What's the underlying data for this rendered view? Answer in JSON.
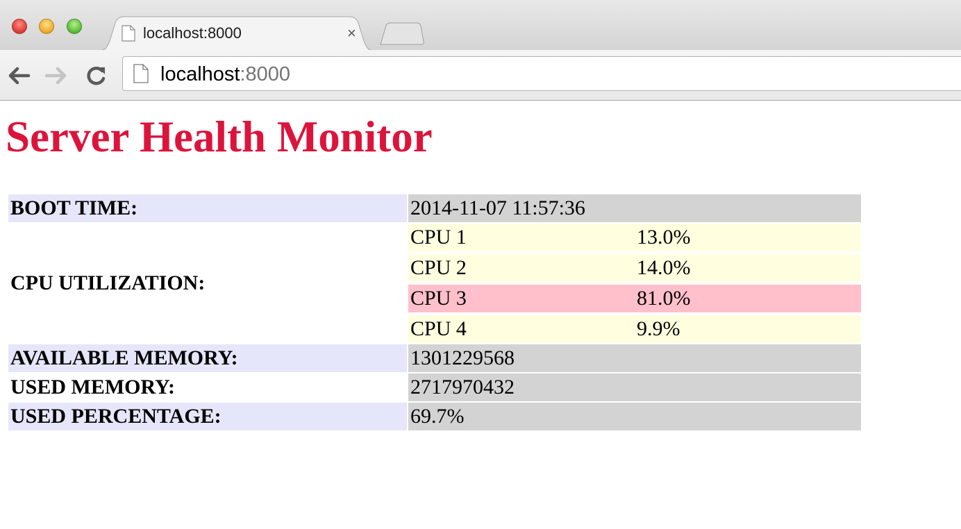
{
  "browser": {
    "tab_title": "localhost:8000",
    "tab_close": "×",
    "address_host": "localhost",
    "address_port": ":8000",
    "icons": [
      "page-icon",
      "back-arrow-icon",
      "forward-arrow-icon",
      "reload-icon",
      "close-icon"
    ]
  },
  "page": {
    "title": "Server Health Monitor",
    "title_color": "#dc143c"
  },
  "stats": {
    "boot_time": {
      "label": "BOOT TIME:",
      "value": "2014-11-07 11:57:36"
    },
    "cpu": {
      "label": "CPU UTILIZATION:",
      "cores": [
        {
          "name": "CPU 1",
          "value": "13.0%"
        },
        {
          "name": "CPU 2",
          "value": "14.0%"
        },
        {
          "name": "CPU 3",
          "value": "81.0%",
          "status": "high"
        },
        {
          "name": "CPU 4",
          "value": "9.9%"
        }
      ]
    },
    "available_memory": {
      "label": "AVAILABLE MEMORY:",
      "value": "1301229568"
    },
    "used_memory": {
      "label": "USED MEMORY:",
      "value": "2717970432"
    },
    "used_percentage": {
      "label": "USED PERCENTAGE:",
      "value": "69.7%"
    }
  },
  "colors": {
    "label_shade": "#e6e6fa",
    "value_bg": "#d3d3d3",
    "cpu_normal_bg": "#ffffe0",
    "cpu_high_bg": "#ffc0cb"
  }
}
